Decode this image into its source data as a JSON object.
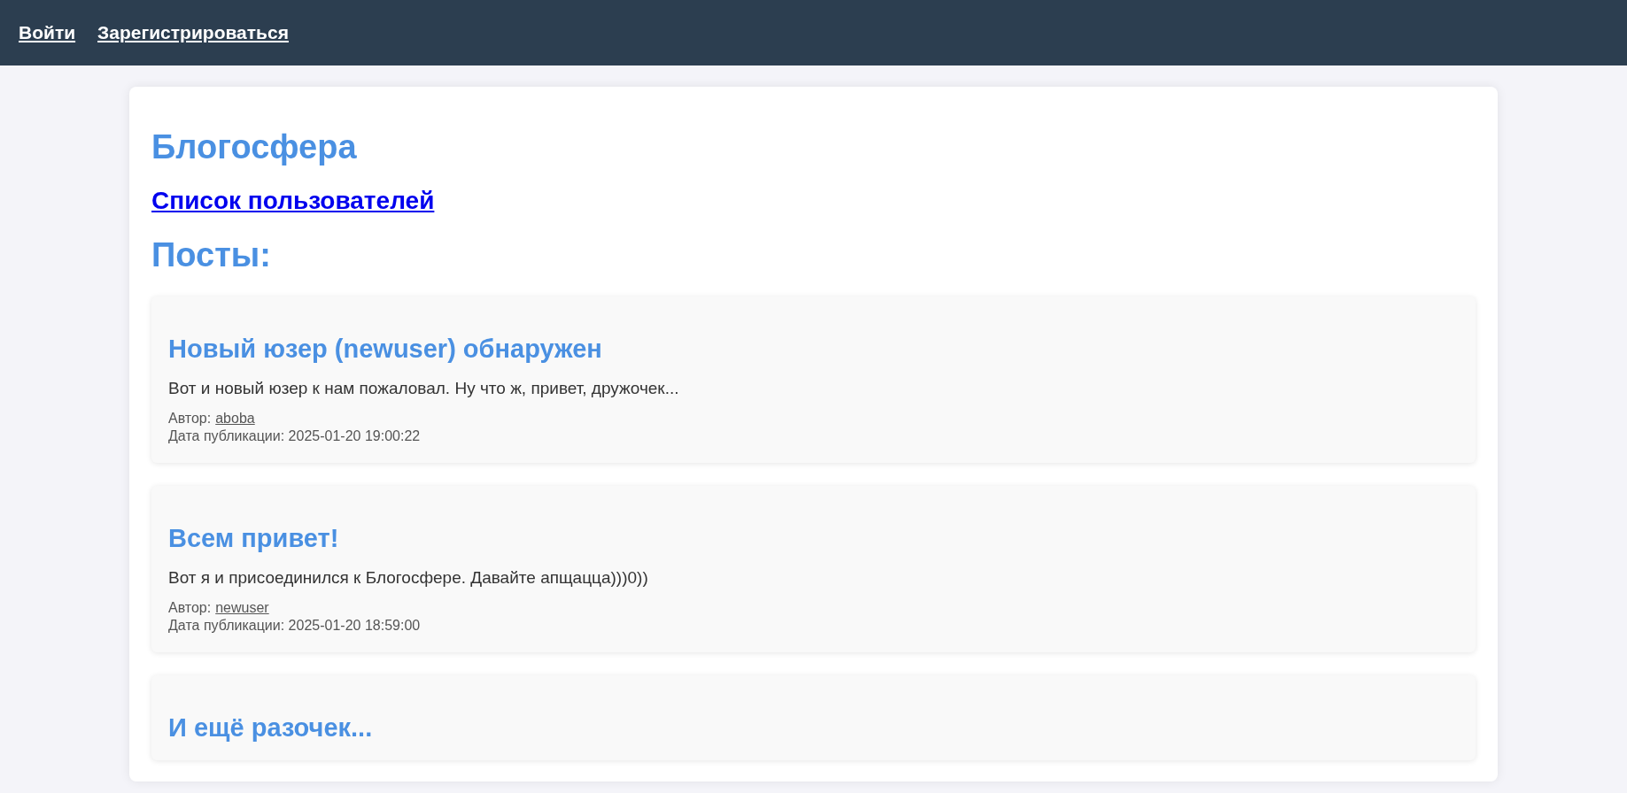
{
  "nav": [
    {
      "label": "Войти"
    },
    {
      "label": "Зарегистрироваться"
    }
  ],
  "site_title": "Блогосфера",
  "users_link": "Список пользователей",
  "posts_heading": "Посты:",
  "posts": [
    {
      "title": "Новый юзер (newuser) обнаружен",
      "body": "Вот и новый юзер к нам пожаловал. Ну что ж, привет, дружочек...",
      "author_label": "Автор:",
      "author": "aboba",
      "date": "Дата публикации: 2025-01-20 19:00:22"
    },
    {
      "title": "Всем привет!",
      "body": "Вот я и присоединился к Блогосфере. Давайте апщацца)))0))",
      "author_label": "Автор:",
      "author": "newuser",
      "date": "Дата публикации: 2025-01-20 18:59:00"
    },
    {
      "title": "И ещё разочек..."
    }
  ]
}
